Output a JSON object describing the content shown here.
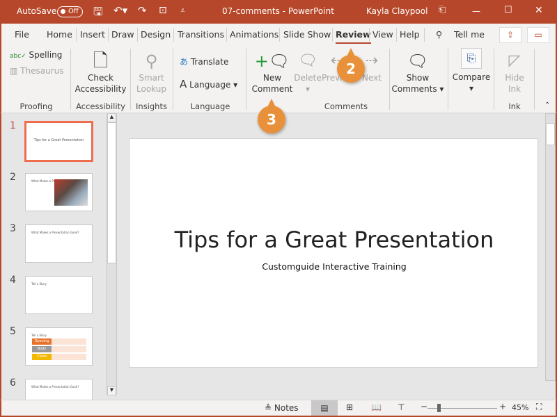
{
  "titlebar": {
    "autosave": "AutoSave",
    "toggle": "Off",
    "doc_title": "07-comments  -  PowerPoint",
    "user": "Kayla Claypool"
  },
  "tabs": [
    "File",
    "Home",
    "Insert",
    "Draw",
    "Design",
    "Transitions",
    "Animations",
    "Slide Show",
    "Review",
    "View",
    "Help"
  ],
  "active_tab": "Review",
  "tell_me": "Tell me",
  "ribbon": {
    "proofing": {
      "label": "Proofing",
      "spelling": "Spelling",
      "thesaurus": "Thesaurus"
    },
    "accessibility": {
      "label": "Accessibility",
      "check1": "Check",
      "check2": "Accessibility"
    },
    "insights": {
      "label": "Insights",
      "smart1": "Smart",
      "smart2": "Lookup"
    },
    "language": {
      "label": "Language",
      "translate": "Translate",
      "language": "Language"
    },
    "comments": {
      "label": "Comments",
      "new1": "New",
      "new2": "Comment",
      "delete": "Delete",
      "previous": "Previous",
      "next": "Next",
      "show1": "Show",
      "show2": "Comments"
    },
    "compare": {
      "compare": "Compare"
    },
    "ink": {
      "label": "Ink",
      "hide1": "Hide",
      "hide2": "Ink"
    }
  },
  "slides": [
    {
      "num": "1",
      "title": "Tips for a Great Presentation",
      "selected": true
    },
    {
      "num": "2",
      "title": "What Makes a Presentation Bad?"
    },
    {
      "num": "3",
      "title": "What Makes a Presentation Good?"
    },
    {
      "num": "4",
      "title": "Tell a Story"
    },
    {
      "num": "5",
      "title": "Tell a Story",
      "steps": [
        "Opening",
        "Body",
        "Close"
      ]
    },
    {
      "num": "6",
      "title": "What Makes a Presentation Good?"
    }
  ],
  "main_slide": {
    "title": "Tips for a Great Presentation",
    "subtitle": "Customguide Interactive Training"
  },
  "status": {
    "notes": "Notes",
    "zoom": "45%",
    "zoom_level_percent": 45
  },
  "callouts": [
    "2",
    "3"
  ],
  "colors": {
    "accent": "#b7472a",
    "callout": "#e8913a",
    "selection": "#ef6c4d"
  }
}
